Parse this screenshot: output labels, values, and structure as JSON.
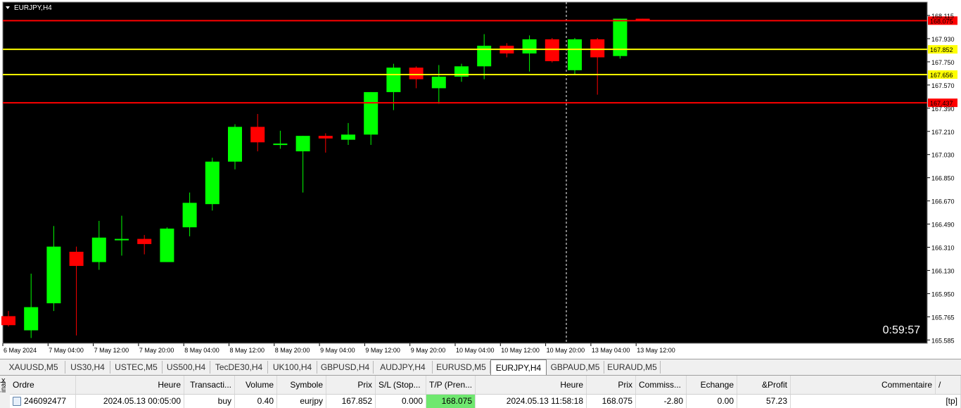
{
  "chart": {
    "title": "EURJPY,H4",
    "countdown": "0:59:57",
    "price_scale": [
      "168.115",
      "167.930",
      "167.750",
      "167.570",
      "167.390",
      "167.210",
      "167.030",
      "166.850",
      "166.670",
      "166.490",
      "166.310",
      "166.130",
      "165.950",
      "165.765",
      "165.585"
    ],
    "time_labels": [
      "6 May 2024",
      "7 May 04:00",
      "7 May 12:00",
      "7 May 20:00",
      "8 May 04:00",
      "8 May 12:00",
      "8 May 20:00",
      "9 May 04:00",
      "9 May 12:00",
      "9 May 20:00",
      "10 May 04:00",
      "10 May 12:00",
      "10 May 20:00",
      "13 May 04:00",
      "13 May 12:00"
    ],
    "levels": [
      {
        "price": 168.075,
        "label": "168.075",
        "color": "#ff0000"
      },
      {
        "price": 167.852,
        "label": "167.852",
        "color": "#ffff00"
      },
      {
        "price": 167.656,
        "label": "167.656",
        "color": "#ffff00"
      },
      {
        "price": 167.437,
        "label": "167.437",
        "color": "#ff0000"
      }
    ],
    "colors": {
      "background": "#000000",
      "bull": "#00ff00",
      "bear": "#ff0000",
      "axis_text": "#000000",
      "grid": "#000000"
    },
    "candles": [
      {
        "o": 165.78,
        "h": 165.82,
        "l": 165.7,
        "c": 165.71
      },
      {
        "o": 165.67,
        "h": 166.11,
        "l": 165.61,
        "c": 165.85
      },
      {
        "o": 165.88,
        "h": 166.48,
        "l": 165.82,
        "c": 166.32
      },
      {
        "o": 166.28,
        "h": 166.32,
        "l": 165.63,
        "c": 166.17
      },
      {
        "o": 166.2,
        "h": 166.52,
        "l": 166.14,
        "c": 166.39
      },
      {
        "o": 166.38,
        "h": 166.56,
        "l": 166.25,
        "c": 166.38
      },
      {
        "o": 166.38,
        "h": 166.41,
        "l": 166.26,
        "c": 166.34
      },
      {
        "o": 166.2,
        "h": 166.47,
        "l": 166.2,
        "c": 166.46
      },
      {
        "o": 166.47,
        "h": 166.74,
        "l": 166.4,
        "c": 166.66
      },
      {
        "o": 166.65,
        "h": 167.01,
        "l": 166.6,
        "c": 166.98
      },
      {
        "o": 166.98,
        "h": 167.27,
        "l": 166.92,
        "c": 167.25
      },
      {
        "o": 167.25,
        "h": 167.35,
        "l": 167.06,
        "c": 167.13
      },
      {
        "o": 167.12,
        "h": 167.22,
        "l": 167.08,
        "c": 167.12
      },
      {
        "o": 167.06,
        "h": 167.18,
        "l": 166.74,
        "c": 167.18
      },
      {
        "o": 167.18,
        "h": 167.2,
        "l": 167.05,
        "c": 167.16
      },
      {
        "o": 167.15,
        "h": 167.28,
        "l": 167.11,
        "c": 167.19
      },
      {
        "o": 167.19,
        "h": 167.52,
        "l": 167.11,
        "c": 167.52
      },
      {
        "o": 167.52,
        "h": 167.74,
        "l": 167.38,
        "c": 167.71
      },
      {
        "o": 167.71,
        "h": 167.72,
        "l": 167.55,
        "c": 167.62
      },
      {
        "o": 167.55,
        "h": 167.73,
        "l": 167.43,
        "c": 167.64
      },
      {
        "o": 167.64,
        "h": 167.74,
        "l": 167.6,
        "c": 167.72
      },
      {
        "o": 167.72,
        "h": 167.97,
        "l": 167.62,
        "c": 167.88
      },
      {
        "o": 167.88,
        "h": 167.9,
        "l": 167.79,
        "c": 167.82
      },
      {
        "o": 167.82,
        "h": 167.96,
        "l": 167.68,
        "c": 167.93
      },
      {
        "o": 167.93,
        "h": 167.94,
        "l": 167.75,
        "c": 167.76
      },
      {
        "o": 167.69,
        "h": 167.94,
        "l": 167.66,
        "c": 167.93
      },
      {
        "o": 167.93,
        "h": 167.94,
        "l": 167.5,
        "c": 167.79
      },
      {
        "o": 167.8,
        "h": 168.09,
        "l": 167.78,
        "c": 168.09
      },
      {
        "o": 168.09,
        "h": 168.09,
        "l": 168.08,
        "c": 168.08
      }
    ]
  },
  "tabs": [
    "XAUUSD,M5",
    "US30,H4",
    "USTEC,M5",
    "US500,H4",
    "TecDE30,H4",
    "UK100,H4",
    "GBPUSD,H4",
    "AUDJPY,H4",
    "EURUSD,M5",
    "EURJPY,H4",
    "GBPAUD,M5",
    "EURAUD,M5"
  ],
  "active_tab": "EURJPY,H4",
  "orders": {
    "side_label": "inal",
    "close_symbol": "x",
    "headers": [
      "Ordre",
      "Heure",
      "Transacti...",
      "Volume",
      "Symbole",
      "Prix",
      "S/L (Stop...",
      "T/P (Pren...",
      "Heure",
      "Prix",
      "Commiss...",
      "Echange",
      "&Profit",
      "Commentaire",
      "/"
    ],
    "rows": [
      [
        "246092477",
        "2024.05.13 00:05:00",
        "buy",
        "0.40",
        "eurjpy",
        "167.852",
        "0.000",
        "168.075",
        "2024.05.13 11:58:18",
        "168.075",
        "-2.80",
        "0.00",
        "57.23",
        "[tp]"
      ]
    ]
  }
}
